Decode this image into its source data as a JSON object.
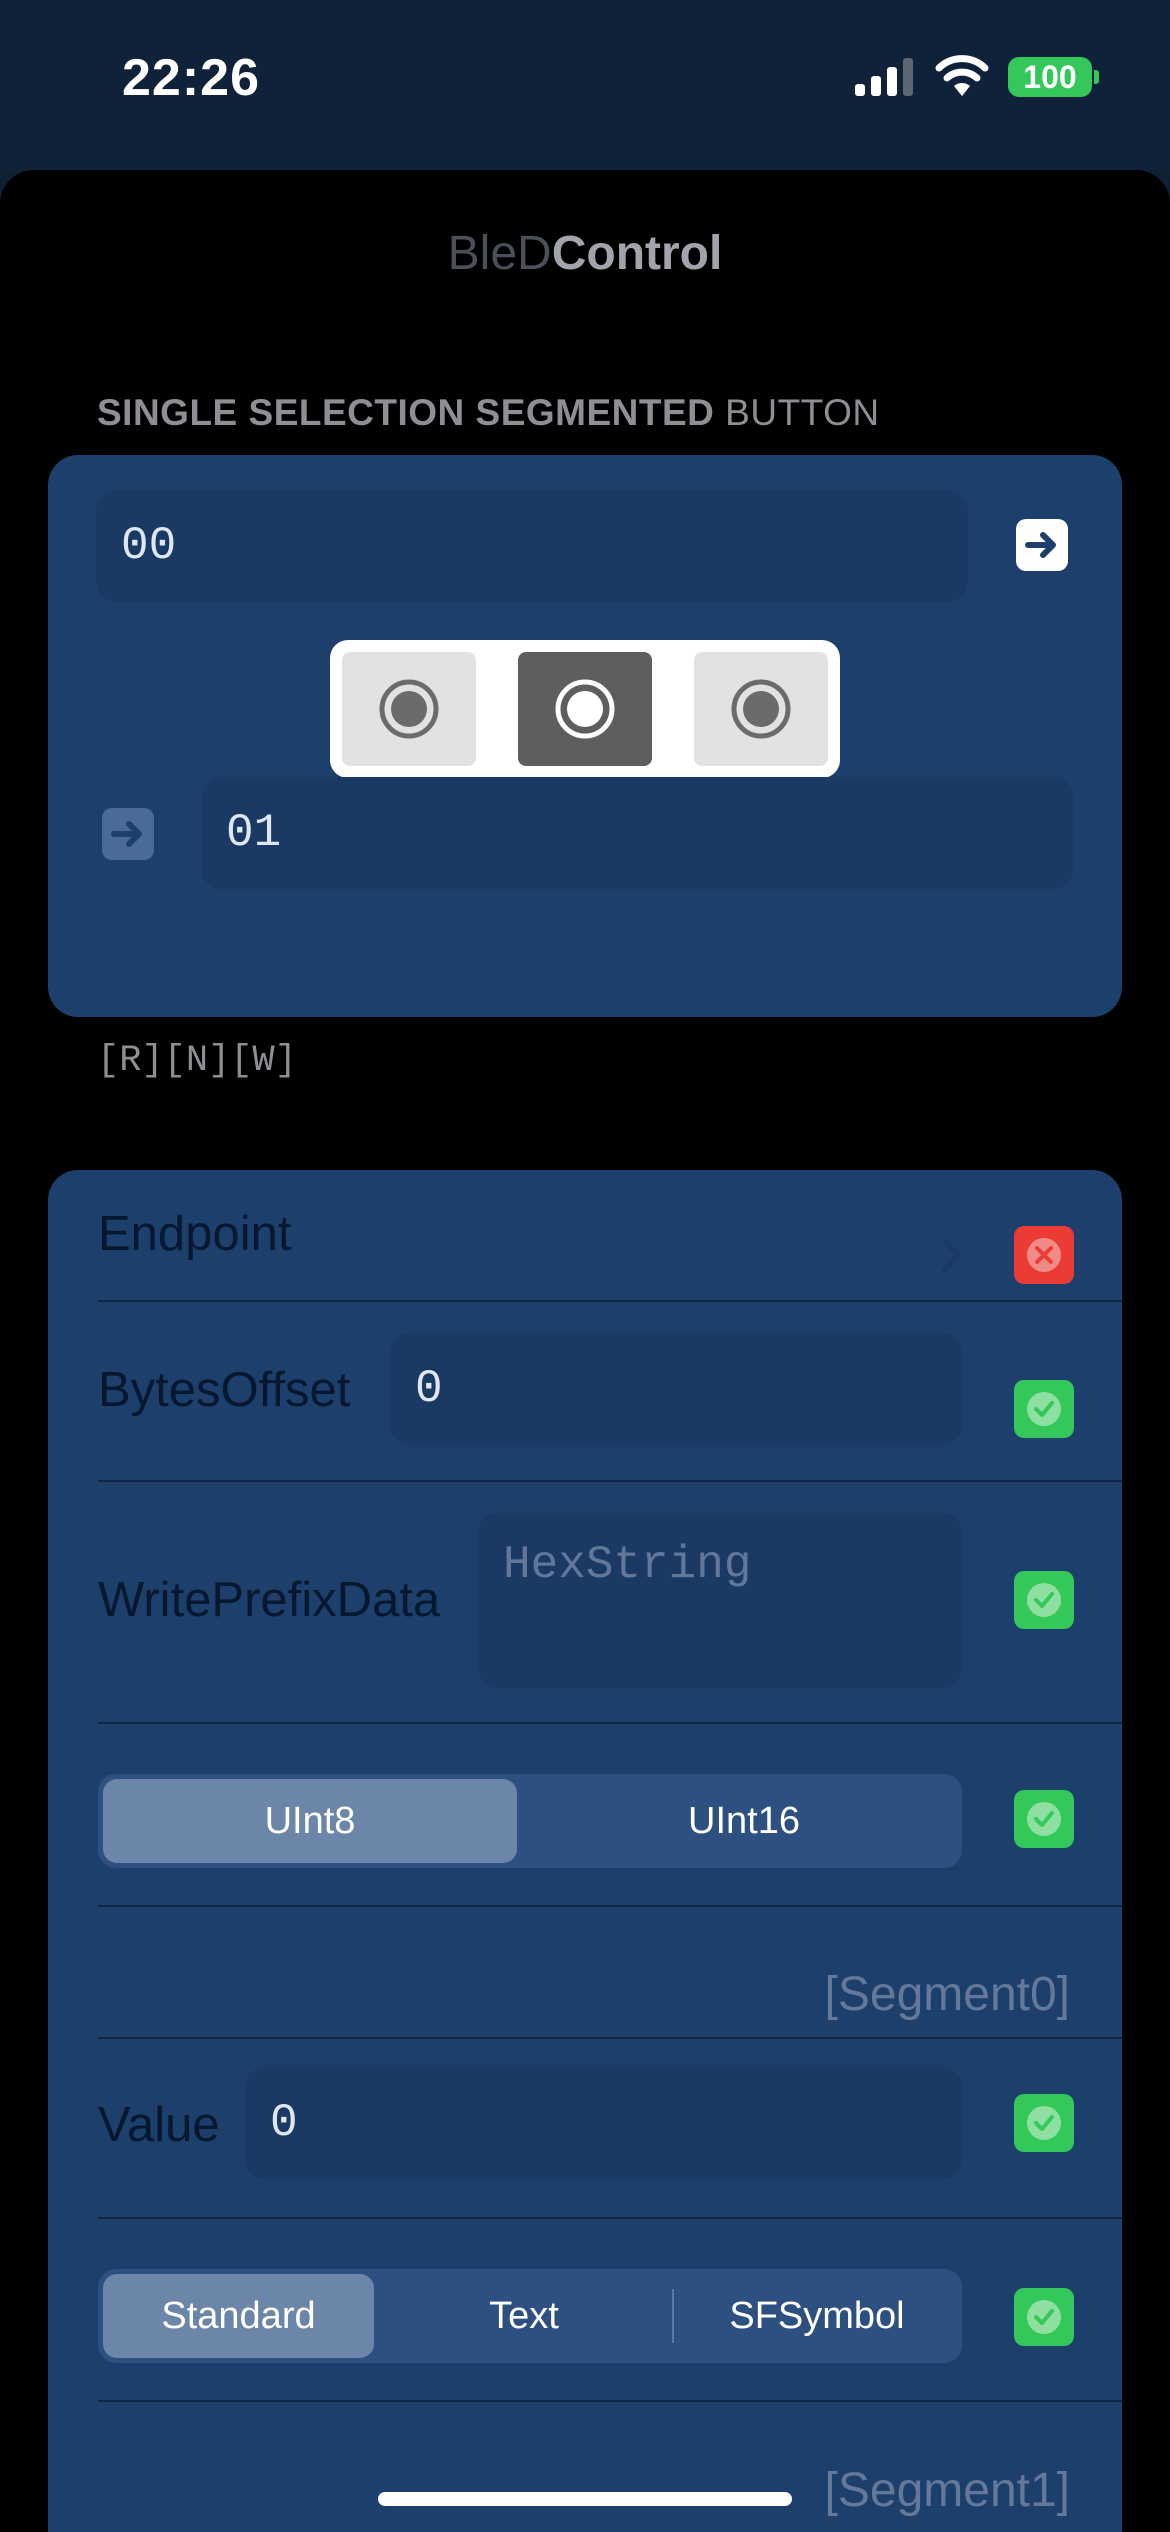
{
  "status": {
    "time": "22:26",
    "battery": "100"
  },
  "app": {
    "title_part1": "BleD",
    "title_part2": "Control"
  },
  "section": {
    "header_bold": "SINGLE SELECTION SEGMENTED",
    "header_rest": " BUTTON"
  },
  "io_card": {
    "input_value": "00",
    "output_value": "01",
    "radio_options": [
      "option-1",
      "option-2",
      "option-3"
    ],
    "selected_index": 1,
    "flags": "[R][N][W]"
  },
  "config": {
    "endpoint_label": "Endpoint",
    "bytes_offset_label": "BytesOffset",
    "bytes_offset_value": "0",
    "write_prefix_label": "WritePrefixData",
    "write_prefix_placeholder": "HexString",
    "int_type": {
      "options": [
        "UInt8",
        "UInt16"
      ],
      "selected": "UInt8"
    },
    "segment0_label": "[Segment0]",
    "value_label": "Value",
    "value_value": "0",
    "display_type": {
      "options": [
        "Standard",
        "Text",
        "SFSymbol"
      ],
      "selected": "Standard"
    },
    "segment1_label": "[Segment1]"
  },
  "colors": {
    "card": "#1d3f6c",
    "field": "#1a3963",
    "ok": "#34c759",
    "error": "#ea3b35",
    "background": "#000000"
  },
  "icons": {
    "submit": "arrow-right-icon",
    "ok": "checkmark-circle-icon",
    "error": "xmark-circle-icon",
    "radio": "radio-circle-icon",
    "chevron": "chevron-right-icon"
  }
}
